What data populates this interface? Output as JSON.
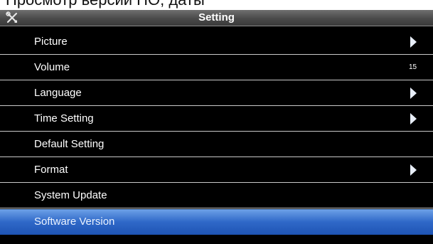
{
  "caption": "Просмотр версии ПО, даты",
  "header": {
    "title": "Setting"
  },
  "menu": [
    {
      "label": "Picture",
      "trailing": "arrow"
    },
    {
      "label": "Volume",
      "value": "15"
    },
    {
      "label": "Language",
      "trailing": "arrow"
    },
    {
      "label": "Time Setting",
      "trailing": "arrow"
    },
    {
      "label": "Default Setting"
    },
    {
      "label": "Format",
      "trailing": "arrow"
    },
    {
      "label": "System Update"
    },
    {
      "label": "Software Version",
      "selected": true
    }
  ],
  "colors": {
    "selected": "#2f68c8",
    "background": "#000000",
    "header": "#4a4a4a"
  },
  "icons": {
    "header": "tools-icon",
    "submenu": "chevron-right-icon"
  }
}
